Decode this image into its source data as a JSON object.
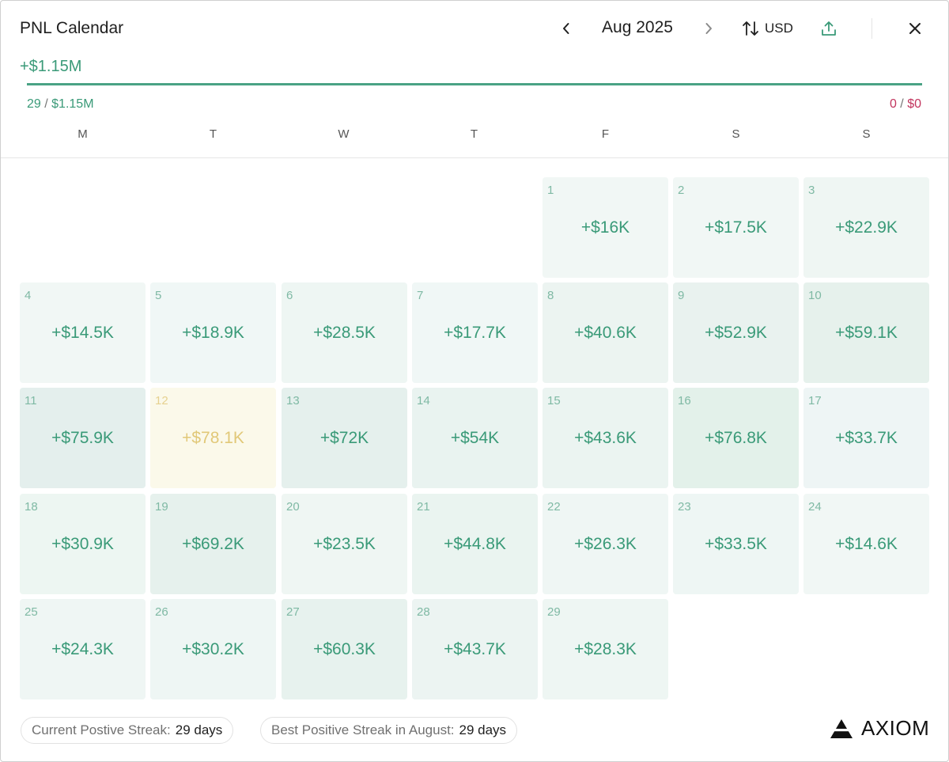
{
  "header": {
    "title": "PNL Calendar",
    "month_label": "Aug 2025",
    "currency": "USD",
    "icons": {
      "prev": "chevron-left-icon",
      "next": "chevron-right-icon",
      "currency": "swap-vertical-icon",
      "share": "share-upload-icon",
      "close": "close-icon"
    }
  },
  "summary": {
    "total_pnl": "+$1.15M",
    "positive_fraction": 1.0,
    "win_count": "29",
    "win_total": "$1.15M",
    "loss_count": "0",
    "loss_total": "$0",
    "separator": "/"
  },
  "weekdays": [
    "M",
    "T",
    "W",
    "T",
    "F",
    "S",
    "S"
  ],
  "calendar": {
    "first_weekday_index": 4,
    "days": [
      {
        "day": "1",
        "pnl": "+$16K",
        "bg": "#f1f7f5"
      },
      {
        "day": "2",
        "pnl": "+$17.5K",
        "bg": "#f1f7f5"
      },
      {
        "day": "3",
        "pnl": "+$22.9K",
        "bg": "#eff6f3"
      },
      {
        "day": "4",
        "pnl": "+$14.5K",
        "bg": "#f1f7f5"
      },
      {
        "day": "5",
        "pnl": "+$18.9K",
        "bg": "#f0f7f6"
      },
      {
        "day": "6",
        "pnl": "+$28.5K",
        "bg": "#eef6f3"
      },
      {
        "day": "7",
        "pnl": "+$17.7K",
        "bg": "#f0f7f6"
      },
      {
        "day": "8",
        "pnl": "+$40.6K",
        "bg": "#ecf4f1"
      },
      {
        "day": "9",
        "pnl": "+$52.9K",
        "bg": "#e9f2ef"
      },
      {
        "day": "10",
        "pnl": "+$59.1K",
        "bg": "#e6f1ec"
      },
      {
        "day": "11",
        "pnl": "+$75.9K",
        "bg": "#e4efed"
      },
      {
        "day": "12",
        "pnl": "+$78.1K",
        "bg": "#fbf9ea",
        "highlight": true
      },
      {
        "day": "13",
        "pnl": "+$72K",
        "bg": "#e5f0ed"
      },
      {
        "day": "14",
        "pnl": "+$54K",
        "bg": "#e9f3f0"
      },
      {
        "day": "15",
        "pnl": "+$43.6K",
        "bg": "#ebf4f1"
      },
      {
        "day": "16",
        "pnl": "+$76.8K",
        "bg": "#e3f1ea"
      },
      {
        "day": "17",
        "pnl": "+$33.7K",
        "bg": "#eef5f5"
      },
      {
        "day": "18",
        "pnl": "+$30.9K",
        "bg": "#edf6f2"
      },
      {
        "day": "19",
        "pnl": "+$69.2K",
        "bg": "#e6f1ed"
      },
      {
        "day": "20",
        "pnl": "+$23.5K",
        "bg": "#eff6f3"
      },
      {
        "day": "21",
        "pnl": "+$44.8K",
        "bg": "#eaf4f0"
      },
      {
        "day": "22",
        "pnl": "+$26.3K",
        "bg": "#eff6f4"
      },
      {
        "day": "23",
        "pnl": "+$33.5K",
        "bg": "#eef6f4"
      },
      {
        "day": "24",
        "pnl": "+$14.6K",
        "bg": "#f1f7f5"
      },
      {
        "day": "25",
        "pnl": "+$24.3K",
        "bg": "#eff6f4"
      },
      {
        "day": "26",
        "pnl": "+$30.2K",
        "bg": "#eef6f4"
      },
      {
        "day": "27",
        "pnl": "+$60.3K",
        "bg": "#e7f2ee"
      },
      {
        "day": "28",
        "pnl": "+$43.7K",
        "bg": "#ecf4f2"
      },
      {
        "day": "29",
        "pnl": "+$28.3K",
        "bg": "#eef6f3"
      }
    ]
  },
  "footer": {
    "current_streak_label": "Current Postive Streak:",
    "current_streak_value": "29 days",
    "best_streak_label": "Best Positive Streak in August:",
    "best_streak_value": "29 days",
    "brand": "AXIOM",
    "brand_icon": "axiom-logo-icon"
  },
  "colors": {
    "positive": "#3a9a78",
    "negative": "#c2355e",
    "progress": "#4aa285",
    "highlight_text": "#e1c878"
  }
}
